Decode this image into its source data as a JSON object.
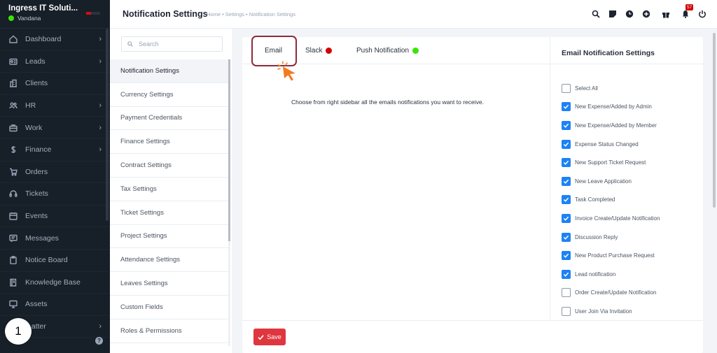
{
  "sidebar": {
    "company": "Ingress IT Soluti...",
    "user": "Vandana",
    "items": [
      {
        "label": "Dashboard",
        "icon": "home-icon",
        "has_arrow": true
      },
      {
        "label": "Leads",
        "icon": "id-card-icon",
        "has_arrow": true
      },
      {
        "label": "Clients",
        "icon": "building-icon",
        "has_arrow": false
      },
      {
        "label": "HR",
        "icon": "people-icon",
        "has_arrow": true
      },
      {
        "label": "Work",
        "icon": "briefcase-icon",
        "has_arrow": true
      },
      {
        "label": "Finance",
        "icon": "dollar-icon",
        "has_arrow": true
      },
      {
        "label": "Orders",
        "icon": "cart-icon",
        "has_arrow": false
      },
      {
        "label": "Tickets",
        "icon": "headset-icon",
        "has_arrow": false
      },
      {
        "label": "Events",
        "icon": "calendar-icon",
        "has_arrow": false
      },
      {
        "label": "Messages",
        "icon": "message-icon",
        "has_arrow": false
      },
      {
        "label": "Notice Board",
        "icon": "clipboard-icon",
        "has_arrow": false
      },
      {
        "label": "Knowledge Base",
        "icon": "book-icon",
        "has_arrow": false
      },
      {
        "label": "Assets",
        "icon": "monitor-icon",
        "has_arrow": false
      },
      {
        "label": "...atter",
        "icon": "",
        "has_arrow": true
      }
    ],
    "help_label": "?",
    "step_badge": "1",
    "arrow": "›"
  },
  "header": {
    "title": "Notification Settings",
    "breadcrumb": "Home • Settings • Notification Settings",
    "notification_count": "57"
  },
  "settings_menu": {
    "search_placeholder": "Search",
    "items": [
      "Notification Settings",
      "Currency Settings",
      "Payment Credentials",
      "Finance Settings",
      "Contract Settings",
      "Tax Settings",
      "Ticket Settings",
      "Project Settings",
      "Attendance Settings",
      "Leaves Settings",
      "Custom Fields",
      "Roles & Permissions"
    ],
    "active_index": 0
  },
  "tabs": [
    {
      "label": "Email",
      "status_color": ""
    },
    {
      "label": "Slack",
      "status_color": "#d30000"
    },
    {
      "label": "Push Notification",
      "status_color": "#39e600"
    }
  ],
  "main": {
    "info_text": "Choose from right sidebar all the emails notifications you want to receive.",
    "save_label": "Save"
  },
  "email_settings": {
    "title": "Email Notification Settings",
    "options": [
      {
        "label": "Select All",
        "checked": false
      },
      {
        "label": "New Expense/Added by Admin",
        "checked": true
      },
      {
        "label": "New Expense/Added by Member",
        "checked": true
      },
      {
        "label": "Expense Status Changed",
        "checked": true
      },
      {
        "label": "New Support Ticket Request",
        "checked": true
      },
      {
        "label": "New Leave Application",
        "checked": true
      },
      {
        "label": "Task Completed",
        "checked": true
      },
      {
        "label": "Invoice Create/Update Notification",
        "checked": true
      },
      {
        "label": "Discussion Reply",
        "checked": true
      },
      {
        "label": "New Product Purchase Request",
        "checked": true
      },
      {
        "label": "Lead notification",
        "checked": true
      },
      {
        "label": "Order Create/Update Notification",
        "checked": false
      },
      {
        "label": "User Join Via Invitation",
        "checked": false
      }
    ]
  },
  "colors": {
    "sidebar_bg": "#171f29",
    "accent_blue": "#1d82f5",
    "save_red": "#e0363f",
    "highlight": "#8b2c3c",
    "cursor_orange": "#f47a20"
  }
}
